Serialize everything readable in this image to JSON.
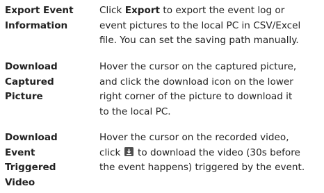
{
  "rows": [
    {
      "term_lines": [
        "Export Event",
        "Information"
      ],
      "desc": {
        "l1_pre": "Click ",
        "l1_bold": "Export",
        "l1_post": " to export the event log or",
        "l2": "event pictures to the local PC in CSV/Excel",
        "l3": "file. You can set the saving path manually."
      }
    },
    {
      "term_lines": [
        "Download",
        "Captured",
        "Picture"
      ],
      "desc_lines": [
        "Hover the cursor on the captured picture,",
        "and click the download icon on the lower",
        "right corner of the picture to download it",
        "to the local PC."
      ]
    },
    {
      "term_lines": [
        "Download",
        "Event",
        "Triggered",
        "Video"
      ],
      "desc": {
        "l1": "Hover the cursor on the recorded video,",
        "l2_pre": "click ",
        "l2_icon": "download-icon",
        "l2_post": " to download the video (30s before",
        "l3": "the event happens) triggered by the event."
      }
    }
  ]
}
